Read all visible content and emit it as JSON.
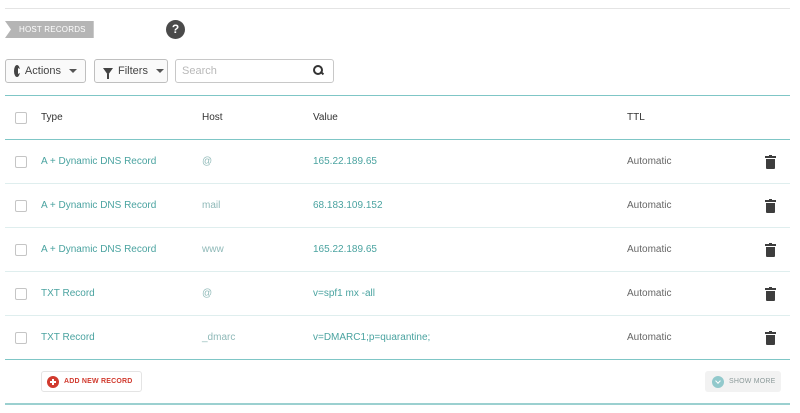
{
  "section": {
    "tag": "HOST RECORDS",
    "help_glyph": "?"
  },
  "toolbar": {
    "actions_label": "Actions",
    "filters_label": "Filters",
    "search_placeholder": "Search"
  },
  "table": {
    "headers": {
      "type": "Type",
      "host": "Host",
      "value": "Value",
      "ttl": "TTL"
    },
    "rows": [
      {
        "type": "A + Dynamic DNS Record",
        "host": "@",
        "value": "165.22.189.65",
        "ttl": "Automatic"
      },
      {
        "type": "A + Dynamic DNS Record",
        "host": "mail",
        "value": "68.183.109.152",
        "ttl": "Automatic"
      },
      {
        "type": "A + Dynamic DNS Record",
        "host": "www",
        "value": "165.22.189.65",
        "ttl": "Automatic"
      },
      {
        "type": "TXT Record",
        "host": "@",
        "value": "v=spf1 mx -all",
        "ttl": "Automatic"
      },
      {
        "type": "TXT Record",
        "host": "_dmarc",
        "value": "v=DMARC1;p=quarantine;",
        "ttl": "Automatic"
      }
    ]
  },
  "footer": {
    "add_label": "ADD NEW RECORD",
    "more_label": "SHOW MORE"
  },
  "icons": [
    "help-icon",
    "play-icon",
    "funnel-icon",
    "caret-icon",
    "search-icon",
    "trash-icon",
    "plus-icon",
    "chevron-down-icon"
  ],
  "colors": {
    "accent": "#4aa3a0",
    "rule": "#7fc6c6",
    "danger": "#d13a2e",
    "tag": "#b5b5b5"
  }
}
